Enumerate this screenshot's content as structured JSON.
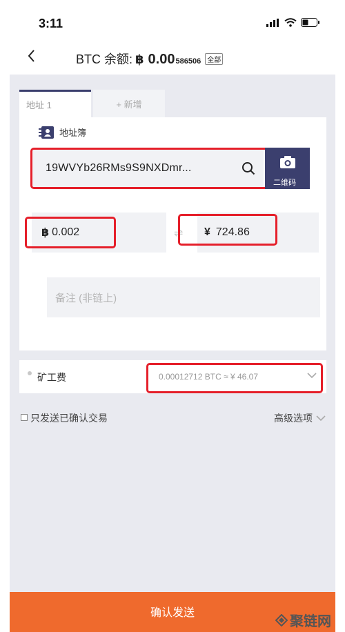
{
  "status_bar": {
    "time": "3:11"
  },
  "nav": {
    "title": "BTC 余额:",
    "coin_symbol": "฿",
    "balance_main": "0.00",
    "balance_small": "586506",
    "all_tag": "全部"
  },
  "tabs": [
    {
      "label": "地址 1"
    },
    {
      "label": "+ 新增"
    }
  ],
  "form": {
    "address_book_label": "地址簿",
    "address_value": "19WVYb26RMs9S9NXDmr...",
    "qr_label": "二维码",
    "btc_symbol": "฿",
    "btc_amount": "0.002",
    "cny_symbol": "¥",
    "cny_amount": "724.86",
    "swap_glyph": "⇌",
    "memo_placeholder": "备注 (非链上)"
  },
  "fee": {
    "label": "矿工费",
    "value": "0.00012712 BTC ≈ ¥ 46.07"
  },
  "options": {
    "confirmed_only_label": "只发送已确认交易",
    "advanced_label": "高级选项"
  },
  "confirm_button_label": "确认发送",
  "watermark": "聚链网",
  "colors": {
    "accent": "#3b3f6e",
    "confirm": "#ef6a2d",
    "highlight": "#e51f2a",
    "background": "#e9eaf0"
  }
}
